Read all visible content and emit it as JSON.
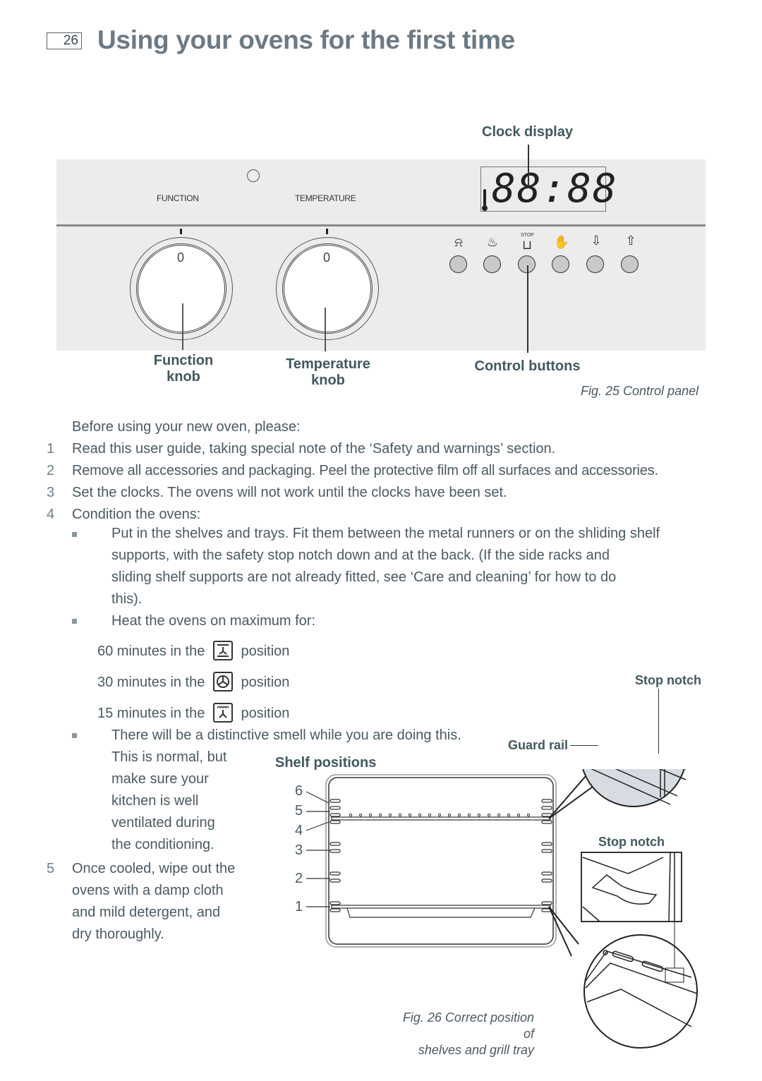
{
  "header": {
    "page_number": "26",
    "title": "Using your ovens for the first time"
  },
  "fig25": {
    "clock_display_label": "Clock display",
    "panel_labels": {
      "function": "FUNCTION",
      "temperature": "TEMPERATURE"
    },
    "clock_value": "88:88",
    "knob_zero": "0",
    "buttons": [
      {
        "icon": "bell-icon",
        "glyph": "⍾",
        "label": ""
      },
      {
        "icon": "pot-steam-icon",
        "glyph": "♨",
        "label": ""
      },
      {
        "icon": "pot-stop-icon",
        "glyph": "⊔",
        "label": "STOP"
      },
      {
        "icon": "hand-icon",
        "glyph": "✋",
        "label": ""
      },
      {
        "icon": "arrow-down-icon",
        "glyph": "⇩",
        "label": ""
      },
      {
        "icon": "arrow-up-icon",
        "glyph": "⇧",
        "label": ""
      }
    ],
    "function_knob_label": [
      "Function",
      "knob"
    ],
    "temperature_knob_label": [
      "Temperature",
      "knob"
    ],
    "control_buttons_label": "Control buttons",
    "caption": "Fig. 25 Control panel"
  },
  "instructions": {
    "intro": "Before using your new oven, please:",
    "steps": [
      {
        "num": "1",
        "text": "Read this user guide, taking special note of the ‘Safety and warnings’ section."
      },
      {
        "num": "2",
        "text": "Remove all accessories and packaging. Peel the protective film off all surfaces and accessories."
      },
      {
        "num": "3",
        "text": "Set the clocks. The ovens will not work until the clocks have been set."
      },
      {
        "num": "4",
        "text": "Condition the ovens:"
      }
    ],
    "bullet1": [
      "Put in the shelves and trays. Fit them between the metal runners or on the shliding shelf",
      "supports, with the safety stop notch down and at the back. (If the side racks and",
      "sliding shelf supports are not already fitted, see  ‘Care and cleaning’ for how to do",
      "this)."
    ],
    "bullet2": "Heat the ovens on maximum for:",
    "durations": [
      {
        "prefix": "60 minutes in the",
        "icon": "bake-element-icon",
        "suffix": "position"
      },
      {
        "prefix": "30 minutes in the",
        "icon": "fan-icon",
        "suffix": "position"
      },
      {
        "prefix": "15 minutes in the",
        "icon": "fan-grill-icon",
        "suffix": "position"
      }
    ],
    "bullet3": [
      "There will be a distinctive smell while you are doing this.",
      "This is normal, but",
      "make sure your",
      "kitchen is well",
      "ventilated during",
      "the conditioning."
    ],
    "step5": {
      "num": "5",
      "lines": [
        "Once cooled, wipe out the",
        "ovens with a damp cloth",
        "and mild detergent, and",
        "dry thoroughly."
      ]
    }
  },
  "fig26": {
    "shelf_positions_title": "Shelf positions",
    "shelf_numbers": [
      "6",
      "5",
      "4",
      "3",
      "2",
      "1"
    ],
    "stop_notch_label_top": "Stop notch",
    "guard_rail_label": "Guard rail",
    "stop_notch_label_bottom": "Stop notch",
    "caption": [
      "Fig. 26 Correct position of",
      "shelves and grill tray"
    ]
  }
}
